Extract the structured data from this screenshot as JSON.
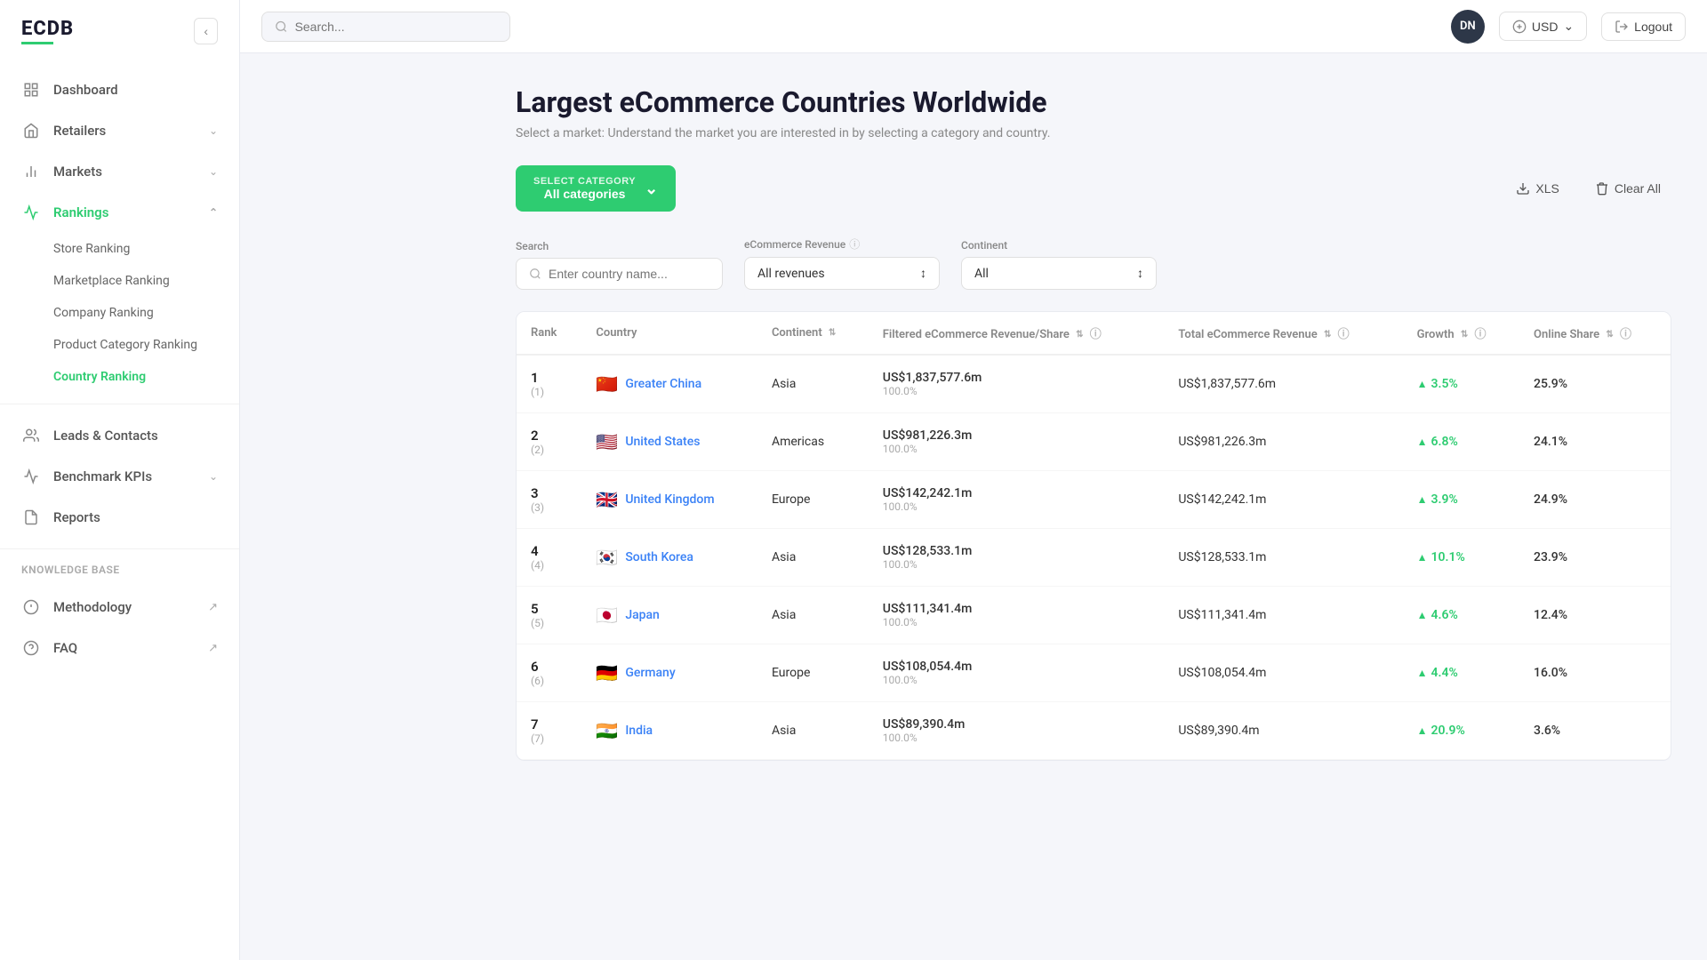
{
  "logo": {
    "text": "ECDB",
    "underline_color": "#2ecc71"
  },
  "topbar": {
    "search_placeholder": "Search...",
    "avatar_initials": "DN",
    "currency_label": "USD",
    "logout_label": "Logout"
  },
  "sidebar": {
    "nav_items": [
      {
        "id": "dashboard",
        "label": "Dashboard",
        "icon": "🏠",
        "has_children": false,
        "active": false
      },
      {
        "id": "retailers",
        "label": "Retailers",
        "icon": "🏪",
        "has_children": true,
        "active": false
      },
      {
        "id": "markets",
        "label": "Markets",
        "icon": "📊",
        "has_children": true,
        "active": false
      },
      {
        "id": "rankings",
        "label": "Rankings",
        "icon": "🏆",
        "has_children": true,
        "active": true
      }
    ],
    "rankings_sub": [
      {
        "id": "store-ranking",
        "label": "Store Ranking",
        "active": false
      },
      {
        "id": "marketplace-ranking",
        "label": "Marketplace Ranking",
        "active": false
      },
      {
        "id": "company-ranking",
        "label": "Company Ranking",
        "active": false
      },
      {
        "id": "product-category-ranking",
        "label": "Product Category Ranking",
        "active": false
      },
      {
        "id": "country-ranking",
        "label": "Country Ranking",
        "active": true
      }
    ],
    "bottom_items": [
      {
        "id": "leads-contacts",
        "label": "Leads & Contacts",
        "icon": "👥",
        "has_children": false,
        "active": false
      },
      {
        "id": "benchmark-kpis",
        "label": "Benchmark KPIs",
        "icon": "📈",
        "has_children": true,
        "active": false
      },
      {
        "id": "reports",
        "label": "Reports",
        "icon": "📄",
        "has_children": false,
        "active": false
      }
    ],
    "knowledge_base_label": "Knowledge Base",
    "knowledge_base_items": [
      {
        "id": "methodology",
        "label": "Methodology",
        "icon": "📋",
        "external": true
      },
      {
        "id": "faq",
        "label": "FAQ",
        "icon": "❓",
        "external": true
      }
    ]
  },
  "page": {
    "title": "Largest eCommerce Countries Worldwide",
    "subtitle": "Select a market: Understand the market you are interested in by selecting a category and country.",
    "select_category_label": "SELECT CATEGORY",
    "select_category_value": "All categories",
    "xls_label": "XLS",
    "clear_all_label": "Clear All"
  },
  "filters": {
    "search_label": "Search",
    "search_placeholder": "Enter country name...",
    "revenue_label": "eCommerce Revenue",
    "revenue_value": "All revenues",
    "continent_label": "Continent",
    "continent_value": "All"
  },
  "table": {
    "columns": [
      {
        "id": "rank",
        "label": "Rank"
      },
      {
        "id": "country",
        "label": "Country"
      },
      {
        "id": "continent",
        "label": "Continent",
        "sortable": true
      },
      {
        "id": "filtered_revenue",
        "label": "Filtered eCommerce Revenue/Share",
        "sortable": true,
        "info": true
      },
      {
        "id": "total_revenue",
        "label": "Total eCommerce Revenue",
        "sortable": true,
        "info": true
      },
      {
        "id": "growth",
        "label": "Growth",
        "sortable": true,
        "info": true
      },
      {
        "id": "online_share",
        "label": "Online Share",
        "sortable": true,
        "info": true
      }
    ],
    "rows": [
      {
        "rank": "1",
        "rank_prev": "(1)",
        "flag": "🇨🇳",
        "country": "Greater China",
        "continent": "Asia",
        "filtered_revenue": "US$1,837,577.6m",
        "filtered_share": "100.0%",
        "total_revenue": "US$1,837,577.6m",
        "growth": "3.5%",
        "growth_up": true,
        "online_share": "25.9%"
      },
      {
        "rank": "2",
        "rank_prev": "(2)",
        "flag": "🇺🇸",
        "country": "United States",
        "continent": "Americas",
        "filtered_revenue": "US$981,226.3m",
        "filtered_share": "100.0%",
        "total_revenue": "US$981,226.3m",
        "growth": "6.8%",
        "growth_up": true,
        "online_share": "24.1%"
      },
      {
        "rank": "3",
        "rank_prev": "(3)",
        "flag": "🇬🇧",
        "country": "United Kingdom",
        "continent": "Europe",
        "filtered_revenue": "US$142,242.1m",
        "filtered_share": "100.0%",
        "total_revenue": "US$142,242.1m",
        "growth": "3.9%",
        "growth_up": true,
        "online_share": "24.9%"
      },
      {
        "rank": "4",
        "rank_prev": "(4)",
        "flag": "🇰🇷",
        "country": "South Korea",
        "continent": "Asia",
        "filtered_revenue": "US$128,533.1m",
        "filtered_share": "100.0%",
        "total_revenue": "US$128,533.1m",
        "growth": "10.1%",
        "growth_up": true,
        "online_share": "23.9%"
      },
      {
        "rank": "5",
        "rank_prev": "(5)",
        "flag": "🇯🇵",
        "country": "Japan",
        "continent": "Asia",
        "filtered_revenue": "US$111,341.4m",
        "filtered_share": "100.0%",
        "total_revenue": "US$111,341.4m",
        "growth": "4.6%",
        "growth_up": true,
        "online_share": "12.4%"
      },
      {
        "rank": "6",
        "rank_prev": "(6)",
        "flag": "🇩🇪",
        "country": "Germany",
        "continent": "Europe",
        "filtered_revenue": "US$108,054.4m",
        "filtered_share": "100.0%",
        "total_revenue": "US$108,054.4m",
        "growth": "4.4%",
        "growth_up": true,
        "online_share": "16.0%"
      },
      {
        "rank": "7",
        "rank_prev": "(7)",
        "flag": "🇮🇳",
        "country": "India",
        "continent": "Asia",
        "filtered_revenue": "US$89,390.4m",
        "filtered_share": "100.0%",
        "total_revenue": "US$89,390.4m",
        "growth": "20.9%",
        "growth_up": true,
        "online_share": "3.6%"
      }
    ]
  }
}
